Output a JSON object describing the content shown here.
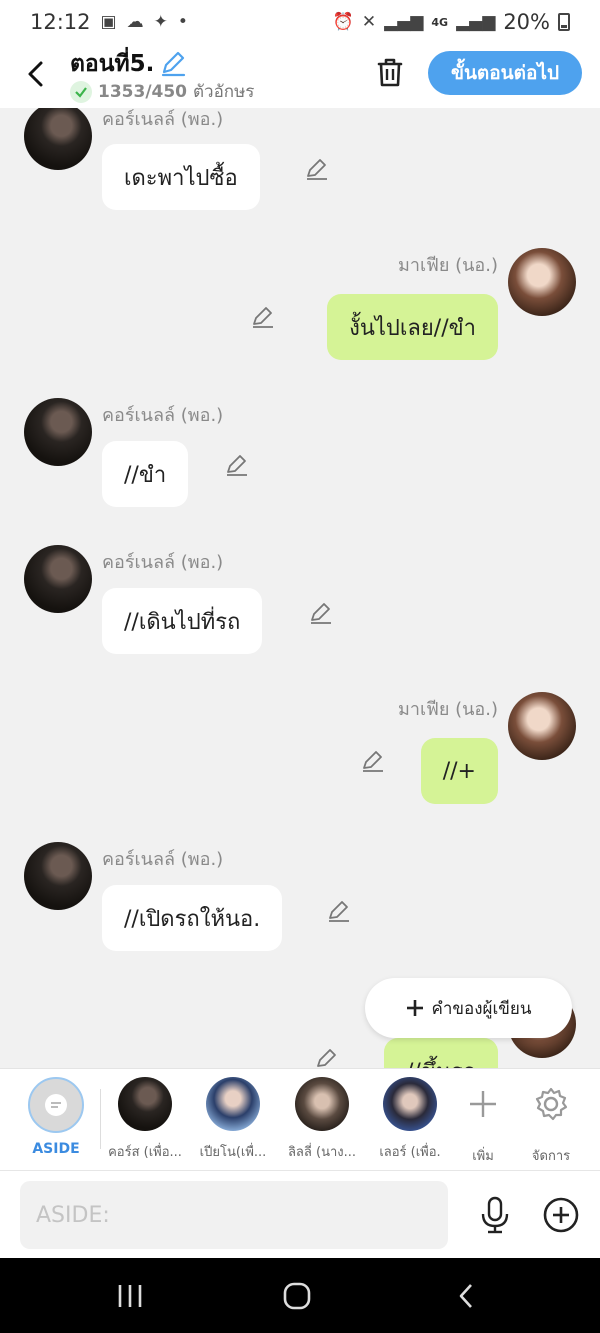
{
  "status_bar": {
    "time": "12:12",
    "network": "4G",
    "battery": "20%"
  },
  "header": {
    "title": "ตอนที่5.",
    "char_count": "1353/450",
    "char_unit": "ตัวอักษร",
    "next_label": "ขั้นตอนต่อไป"
  },
  "messages": [
    {
      "side": "left",
      "name": "คอร์เนลล์ (พอ.)",
      "text": "เดะพาไปซื้อ"
    },
    {
      "side": "right",
      "name": "มาเฟีย (นอ.)",
      "text": "งั้นไปเลย//ขำ"
    },
    {
      "side": "left",
      "name": "คอร์เนลล์ (พอ.)",
      "text": "//ขำ"
    },
    {
      "side": "left",
      "name": "คอร์เนลล์ (พอ.)",
      "text": "//เดินไปที่รถ"
    },
    {
      "side": "right",
      "name": "มาเฟีย (นอ.)",
      "text": "//+"
    },
    {
      "side": "left",
      "name": "คอร์เนลล์ (พอ.)",
      "text": "//เปิดรถให้นอ."
    },
    {
      "side": "right",
      "name": "",
      "text": "//ขึ้นรถ"
    }
  ],
  "aside_chip": {
    "label": "คำของผู้เขียน"
  },
  "character_bar": {
    "aside_label": "ASIDE",
    "characters": [
      "คอร์ส (เพื่อ...",
      "เปียโน(เพื่...",
      "ลิลลี่ (นาง...",
      "เลอร์ (เพื่อ."
    ],
    "add_label": "เพิ่ม",
    "manage_label": "จัดการ"
  },
  "input": {
    "placeholder": "ASIDE:"
  },
  "colors": {
    "accent": "#4ea2ee",
    "right_bubble": "#d5f396",
    "left_bubble": "#ffffff",
    "background": "#f1f1f1"
  }
}
